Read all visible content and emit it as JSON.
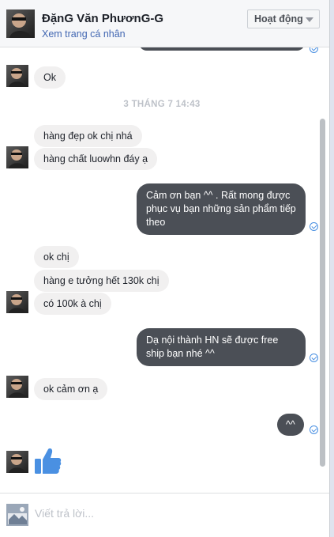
{
  "header": {
    "name": "ĐặnG Văn PhươnG-G",
    "profile_link": "Xem trang cá nhân",
    "status": "Hoạt động"
  },
  "messages": {
    "m1": "Ok",
    "time_separator": "3 THÁNG 7 14:43",
    "m2": "hàng đẹp ok chị nhá",
    "m3": "hàng chất luowhn đáy ạ",
    "m4": "Cảm ơn bạn ^^ . Rất mong được phục vụ bạn những sản phẩm tiếp theo",
    "m5": "ok chị",
    "m6": "hàng e tưởng hết 130k chị",
    "m7": "có 100k à chị",
    "m8": "Dạ nội thành HN sẽ được free ship bạn nhé ^^",
    "m9": "ok cảm ơn ạ",
    "m10": "^^"
  },
  "reply": {
    "placeholder": "Viết trả lời..."
  },
  "colors": {
    "incoming_bubble": "#f1f0f0",
    "outgoing_bubble": "#4b4f56",
    "link": "#4267b2",
    "like_blue": "#4a90e2"
  }
}
